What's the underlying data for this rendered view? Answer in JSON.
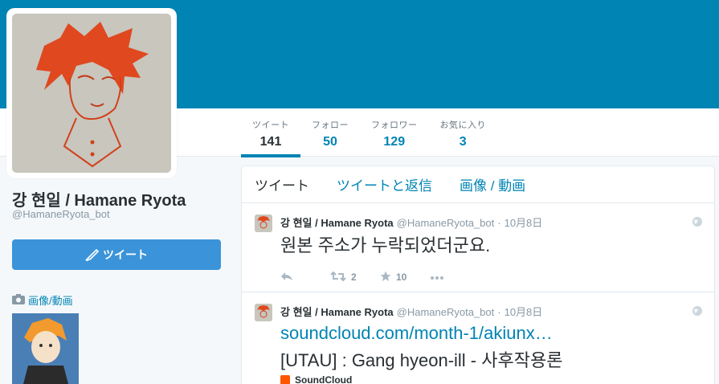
{
  "profile": {
    "name": "강 현일 / Hamane Ryota",
    "handle": "@HamaneRyota_bot"
  },
  "nav": {
    "stats": [
      {
        "label": "ツイート",
        "value": "141"
      },
      {
        "label": "フォロー",
        "value": "50"
      },
      {
        "label": "フォロワー",
        "value": "129"
      },
      {
        "label": "お気に入り",
        "value": "3"
      }
    ]
  },
  "sidebar": {
    "tweet_button_label": "ツイート",
    "media_link_label": "画像/動画"
  },
  "timeline": {
    "tabs": [
      "ツイート",
      "ツイートと返信",
      "画像 / 動画"
    ],
    "tweets": [
      {
        "name": "강 현일 / Hamane Ryota",
        "handle": "@HamaneRyota_bot",
        "dot": "·",
        "time": "10月8日",
        "text": "원본 주소가 누락되었더군요.",
        "retweets": "2",
        "favorites": "10"
      },
      {
        "name": "강 현일 / Hamane Ryota",
        "handle": "@HamaneRyota_bot",
        "dot": "·",
        "time": "10月8日",
        "link": "soundcloud.com/month-1/akiunx…",
        "text": "[UTAU] : Gang hyeon-ill - 사후작용론",
        "card_source": "SoundCloud"
      }
    ]
  },
  "colors": {
    "header": "#0084b4",
    "accent": "#0084b4",
    "tweet_button": "#3b94d9"
  },
  "icons": {
    "reply": "reply-icon",
    "retweet": "retweet-icon",
    "favorite": "star-icon",
    "more": "more-icon",
    "globe": "globe-icon",
    "camera": "camera-icon",
    "quill": "quill-icon"
  }
}
